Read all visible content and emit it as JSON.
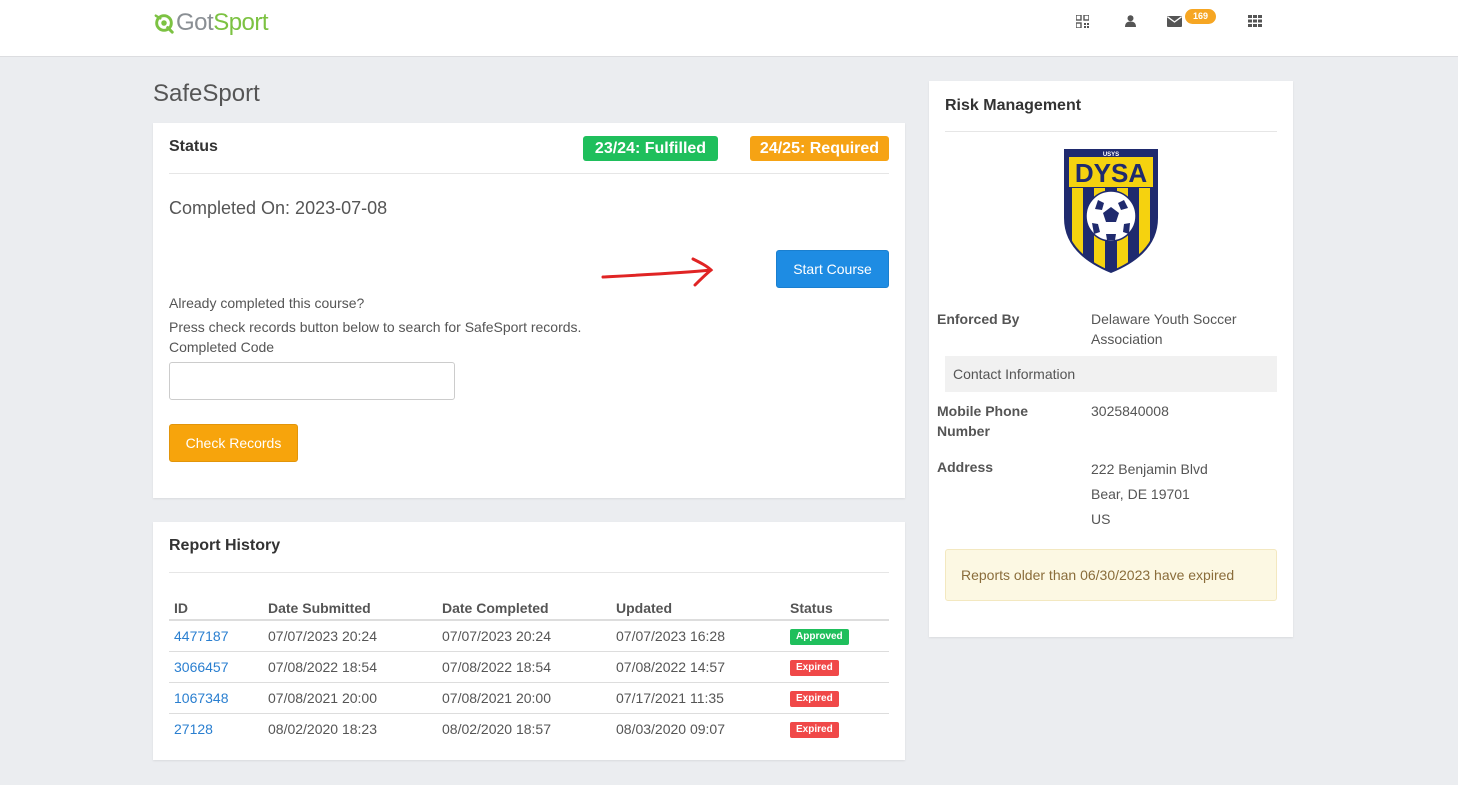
{
  "brand": {
    "got": "Got",
    "sport": "Sport",
    "green": "#7cc242",
    "gray": "#8a8f94"
  },
  "nav": {
    "icons": [
      "qr-code-icon",
      "user-icon",
      "envelope-icon",
      "apps-grid-icon"
    ],
    "message_count": "169"
  },
  "page": {
    "title": "SafeSport"
  },
  "status": {
    "heading": "Status",
    "badges": [
      {
        "label": "23/24: Fulfilled",
        "color": "#1fbf5c"
      },
      {
        "label": "24/25: Required",
        "color": "#f6a314"
      }
    ],
    "completed_on": "Completed On: 2023-07-08",
    "start_course_label": "Start Course",
    "already_completed": "Already completed this course?",
    "press_check": "Press check records button below to search for SafeSport records.",
    "completed_code_label": "Completed Code",
    "completed_code_value": "",
    "check_records_label": "Check Records"
  },
  "report_history": {
    "heading": "Report History",
    "columns": [
      "ID",
      "Date Submitted",
      "Date Completed",
      "Updated",
      "Status"
    ],
    "rows": [
      {
        "id": "4477187",
        "submitted": "07/07/2023 20:24",
        "completed": "07/07/2023 20:24",
        "updated": "07/07/2023 16:28",
        "status": "Approved"
      },
      {
        "id": "3066457",
        "submitted": "07/08/2022 18:54",
        "completed": "07/08/2022 18:54",
        "updated": "07/08/2022 14:57",
        "status": "Expired"
      },
      {
        "id": "1067348",
        "submitted": "07/08/2021 20:00",
        "completed": "07/08/2021 20:00",
        "updated": "07/17/2021 11:35",
        "status": "Expired"
      },
      {
        "id": "27128",
        "submitted": "08/02/2020 18:23",
        "completed": "08/02/2020 18:57",
        "updated": "08/03/2020 09:07",
        "status": "Expired"
      }
    ]
  },
  "risk": {
    "heading": "Risk Management",
    "crest": {
      "top_text": "USYS",
      "main_text": "DYSA"
    },
    "enforced_by_label": "Enforced By",
    "enforced_by_line1": "Delaware Youth Soccer",
    "enforced_by_line2": "Association",
    "contact_info_label": "Contact Information",
    "mobile_label_line1": "Mobile Phone",
    "mobile_label_line2": "Number",
    "mobile_value": "3025840008",
    "address_label": "Address",
    "address_line1": "222 Benjamin Blvd",
    "address_line2": "Bear, DE 19701",
    "address_line3": "US",
    "alert": "Reports older than 06/30/2023 have expired"
  }
}
